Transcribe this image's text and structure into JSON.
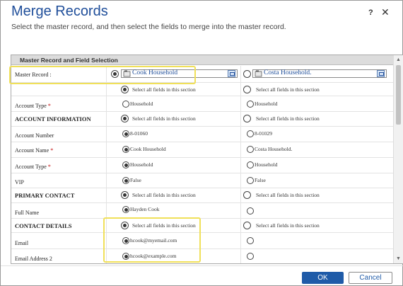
{
  "dialog": {
    "title": "Merge Records",
    "subtitle": "Select the master record, and then select the fields to merge into the master record.",
    "help": "?",
    "close": "✕",
    "section_title": "Master Record and Field Selection",
    "select_all": "Select all fields in this section",
    "ok": "OK",
    "cancel": "Cancel"
  },
  "master": {
    "label": "Master Record :",
    "left": "Cook Household",
    "right": "Costa Household."
  },
  "rows": {
    "account_type_top": {
      "label": "Account Type",
      "left": "Household",
      "right": "Household"
    },
    "account_info": {
      "label": "ACCOUNT INFORMATION"
    },
    "account_number": {
      "label": "Account Number",
      "left": "8-01060",
      "right": "8-01029"
    },
    "account_name": {
      "label": "Account Name",
      "left": "Cook Household",
      "right": "Costa Household."
    },
    "account_type": {
      "label": "Account Type",
      "left": "Household",
      "right": "Household"
    },
    "vip": {
      "label": "VIP",
      "left": "False",
      "right": "False"
    },
    "primary_contact": {
      "label": "PRIMARY CONTACT"
    },
    "full_name": {
      "label": "Full Name",
      "left": "Hayden Cook",
      "right": ""
    },
    "contact_details": {
      "label": "CONTACT DETAILS"
    },
    "email": {
      "label": "Email",
      "left": "hcook@myemail.com",
      "right": ""
    },
    "email2": {
      "label": "Email Address 2",
      "left": "hcook@example.com",
      "right": ""
    }
  },
  "required_mark": "*"
}
